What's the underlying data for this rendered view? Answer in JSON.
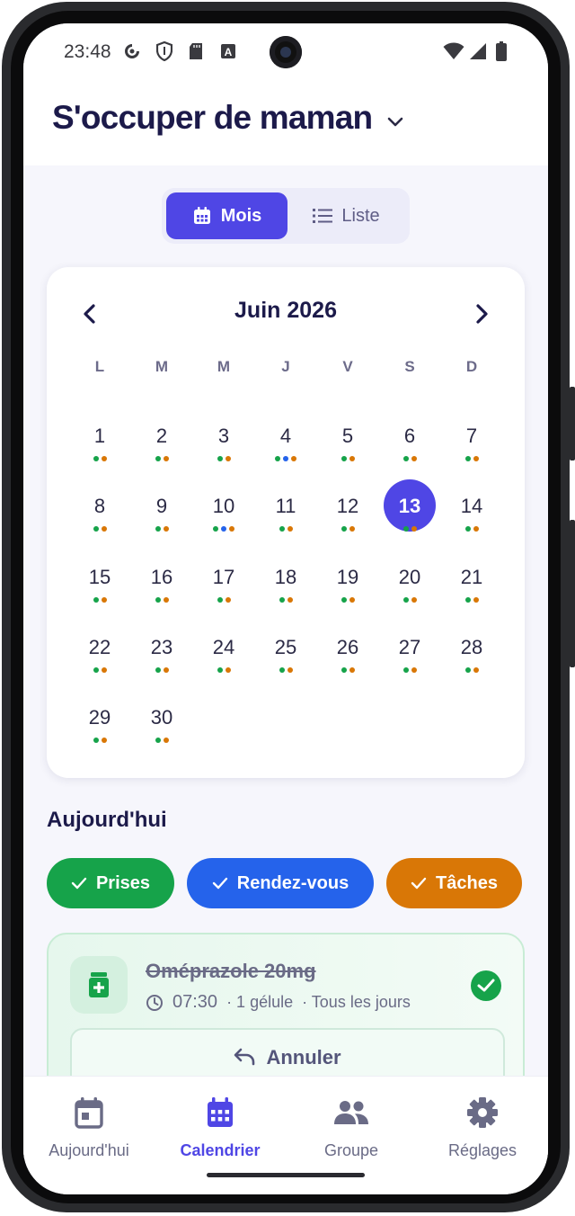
{
  "status_bar": {
    "time": "23:48"
  },
  "header": {
    "title": "S'occuper de maman"
  },
  "view_toggle": {
    "month_label": "Mois",
    "list_label": "Liste",
    "active": "month"
  },
  "calendar": {
    "month_label": "Juin 2026",
    "weekdays": [
      "L",
      "M",
      "M",
      "J",
      "V",
      "S",
      "D"
    ],
    "selected_day": 13,
    "days": [
      {
        "n": "1",
        "dots": [
          "green",
          "orange"
        ]
      },
      {
        "n": "2",
        "dots": [
          "green",
          "orange"
        ]
      },
      {
        "n": "3",
        "dots": [
          "green",
          "orange"
        ]
      },
      {
        "n": "4",
        "dots": [
          "green",
          "blue",
          "orange"
        ]
      },
      {
        "n": "5",
        "dots": [
          "green",
          "orange"
        ]
      },
      {
        "n": "6",
        "dots": [
          "green",
          "orange"
        ]
      },
      {
        "n": "7",
        "dots": [
          "green",
          "orange"
        ]
      },
      {
        "n": "8",
        "dots": [
          "green",
          "orange"
        ]
      },
      {
        "n": "9",
        "dots": [
          "green",
          "orange"
        ]
      },
      {
        "n": "10",
        "dots": [
          "green",
          "blue",
          "orange"
        ]
      },
      {
        "n": "11",
        "dots": [
          "green",
          "orange"
        ]
      },
      {
        "n": "12",
        "dots": [
          "green",
          "orange"
        ]
      },
      {
        "n": "13",
        "dots": [
          "green",
          "orange"
        ]
      },
      {
        "n": "14",
        "dots": [
          "green",
          "orange"
        ]
      },
      {
        "n": "15",
        "dots": [
          "green",
          "orange"
        ]
      },
      {
        "n": "16",
        "dots": [
          "green",
          "orange"
        ]
      },
      {
        "n": "17",
        "dots": [
          "green",
          "orange"
        ]
      },
      {
        "n": "18",
        "dots": [
          "green",
          "orange"
        ]
      },
      {
        "n": "19",
        "dots": [
          "green",
          "orange"
        ]
      },
      {
        "n": "20",
        "dots": [
          "green",
          "orange"
        ]
      },
      {
        "n": "21",
        "dots": [
          "green",
          "orange"
        ]
      },
      {
        "n": "22",
        "dots": [
          "green",
          "orange"
        ]
      },
      {
        "n": "23",
        "dots": [
          "green",
          "orange"
        ]
      },
      {
        "n": "24",
        "dots": [
          "green",
          "orange"
        ]
      },
      {
        "n": "25",
        "dots": [
          "green",
          "orange"
        ]
      },
      {
        "n": "26",
        "dots": [
          "green",
          "orange"
        ]
      },
      {
        "n": "27",
        "dots": [
          "green",
          "orange"
        ]
      },
      {
        "n": "28",
        "dots": [
          "green",
          "orange"
        ]
      },
      {
        "n": "29",
        "dots": [
          "green",
          "orange"
        ]
      },
      {
        "n": "30",
        "dots": [
          "green",
          "orange"
        ]
      }
    ],
    "dot_colors": {
      "green": "#16a34a",
      "blue": "#2563eb",
      "orange": "#d97706"
    }
  },
  "today": {
    "heading": "Aujourd'hui",
    "filters": [
      {
        "label": "Prises",
        "color": "#16a34a"
      },
      {
        "label": "Rendez-vous",
        "color": "#2563eb"
      },
      {
        "label": "Tâches",
        "color": "#d97706"
      }
    ],
    "medication": {
      "name": "Oméprazole 20mg",
      "time": "07:30",
      "dose": "· 1 gélule",
      "frequency": "· Tous les jours",
      "status": "done",
      "undo_label": "Annuler"
    }
  },
  "bottom_nav": {
    "items": [
      {
        "label": "Aujourd'hui",
        "icon": "calendar-today-icon",
        "active": false
      },
      {
        "label": "Calendrier",
        "icon": "calendar-month-icon",
        "active": true
      },
      {
        "label": "Groupe",
        "icon": "group-icon",
        "active": false
      },
      {
        "label": "Réglages",
        "icon": "gear-icon",
        "active": false
      }
    ]
  },
  "colors": {
    "accent": "#4f46e5",
    "title": "#1c1a4a"
  }
}
